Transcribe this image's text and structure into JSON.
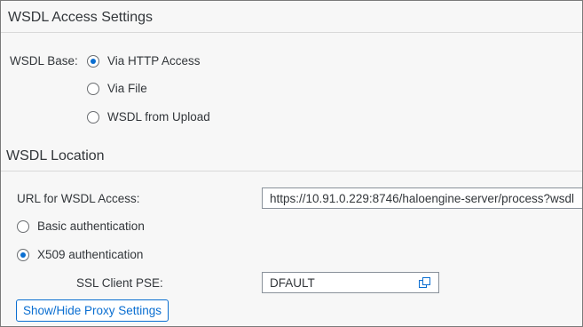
{
  "access_settings": {
    "title": "WSDL Access Settings",
    "wsdl_base_label": "WSDL Base:",
    "options": [
      {
        "label": "Via HTTP Access",
        "selected": true
      },
      {
        "label": "Via File",
        "selected": false
      },
      {
        "label": "WSDL from Upload",
        "selected": false
      }
    ]
  },
  "location": {
    "title": "WSDL Location",
    "url_label": "URL for WSDL Access:",
    "url_value": "https://10.91.0.229:8746/haloengine-server/process?wsdl",
    "auth_options": [
      {
        "label": "Basic authentication",
        "selected": false
      },
      {
        "label": "X509 authentication",
        "selected": true
      }
    ],
    "ssl_pse_label": "SSL Client PSE:",
    "ssl_pse_value": "DFAULT",
    "value_help_icon": "value-help-icon",
    "proxy_button_label": "Show/Hide Proxy Settings"
  },
  "colors": {
    "accent": "#0a6ed1",
    "background": "#f7f7f7",
    "text": "#32363a"
  }
}
